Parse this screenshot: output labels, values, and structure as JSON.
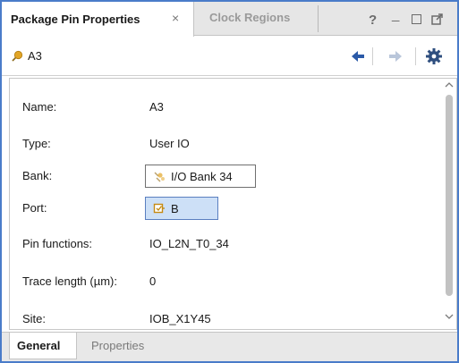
{
  "tabs": {
    "active_label": "Package Pin Properties",
    "close_glyph": "×",
    "inactive_label": "Clock Regions"
  },
  "window_controls": {
    "help": "?",
    "minimize": "_"
  },
  "toolbar": {
    "pin_name": "A3",
    "pin_icon": "pin-icon",
    "back_icon": "arrow-left-icon",
    "forward_icon": "arrow-right-icon",
    "settings_icon": "gear-icon"
  },
  "properties": {
    "name": {
      "label": "Name:",
      "value": "A3"
    },
    "type": {
      "label": "Type:",
      "value": "User IO"
    },
    "bank": {
      "label": "Bank:",
      "value": "I/O Bank 34",
      "icon": "bank-icon"
    },
    "port": {
      "label": "Port:",
      "value": "B",
      "icon": "port-icon"
    },
    "pin_functions": {
      "label": "Pin functions:",
      "value": "IO_L2N_T0_34"
    },
    "trace_length": {
      "label": "Trace length (µm):",
      "value": "0"
    },
    "site": {
      "label": "Site:",
      "value": "IOB_X1Y45"
    }
  },
  "bottom_tabs": {
    "general": "General",
    "properties": "Properties"
  },
  "colors": {
    "frame_border": "#4a7cc9",
    "selection_fill": "#cde0f7",
    "nav_arrow_active": "#2b5aa8",
    "nav_arrow_inactive": "#b9c6da",
    "pin_icon": "#e2a526",
    "gear": "#2f4f7f"
  }
}
